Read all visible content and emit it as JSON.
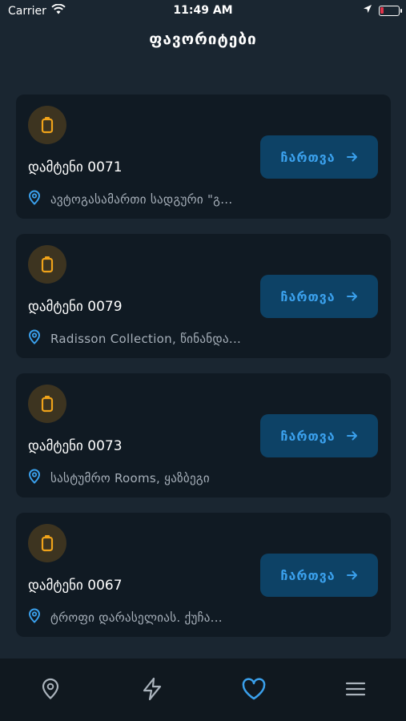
{
  "status_bar": {
    "carrier": "Carrier",
    "time": "11:49 AM"
  },
  "header": {
    "title": "ფავორიტები"
  },
  "favorites": [
    {
      "title": "დამტენი 0071",
      "location": "ავტოგასამართი სადგური \"გ...",
      "button_label": "ჩართვა"
    },
    {
      "title": "დამტენი 0079",
      "location": "Radisson Collection, წინანდა...",
      "button_label": "ჩართვა"
    },
    {
      "title": "დამტენი 0073",
      "location": "სასტუმრო Rooms, ყაზბეგი",
      "button_label": "ჩართვა"
    },
    {
      "title": "დამტენი 0067",
      "location": "ტროფი დარასელიას. ქუჩა...",
      "button_label": "ჩართვა"
    }
  ],
  "tabbar": {
    "tabs": [
      {
        "icon": "map-pin-icon",
        "active": false
      },
      {
        "icon": "lightning-icon",
        "active": false
      },
      {
        "icon": "heart-icon",
        "active": true
      },
      {
        "icon": "menu-icon",
        "active": false
      }
    ]
  },
  "colors": {
    "background": "#1a2631",
    "card": "#101a23",
    "accent": "#3aa0ec",
    "button_bg": "#0d4266",
    "charger_icon": "#f0a31a",
    "muted_text": "#a7b0ba",
    "inactive_icon": "#aab3bc"
  }
}
